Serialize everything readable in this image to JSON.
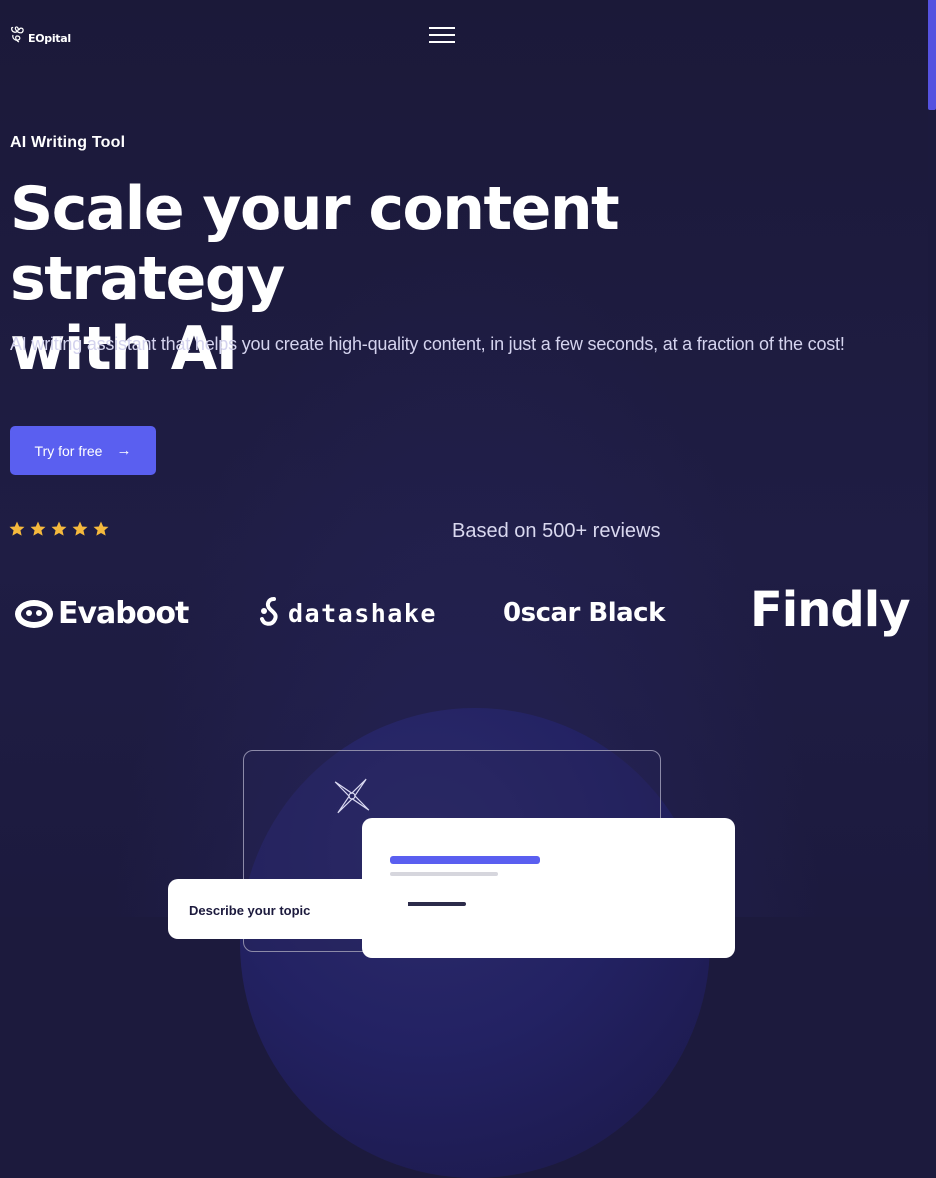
{
  "brand": {
    "name": "EOpital"
  },
  "hero": {
    "eyebrow": "AI Writing Tool",
    "headline_line1": "Scale your content strategy",
    "headline_line2": "with AI",
    "subheadline": "AI writing assistant that helps you create high-quality content, in just a few seconds, at a fraction of the cost!",
    "cta_label": "Try for free",
    "cta_icon": "arrow-right-icon"
  },
  "rating": {
    "stars": 5,
    "max_stars": 5,
    "reviews_text": "Based on 500+ reviews"
  },
  "brands": [
    {
      "name": "Evaboot",
      "icon": "evaboot-logo-icon"
    },
    {
      "name": "datashake",
      "icon": "datashake-logo-icon"
    },
    {
      "name": "Oscar Black",
      "display": "0scar Black"
    },
    {
      "name": "Findly"
    }
  ],
  "preview": {
    "topic_label": "Describe your topic"
  },
  "colors": {
    "background": "#1c1a3d",
    "accent": "#5a5ff0",
    "star": "#f5b93d",
    "scrollbar_thumb": "#5552e0"
  }
}
